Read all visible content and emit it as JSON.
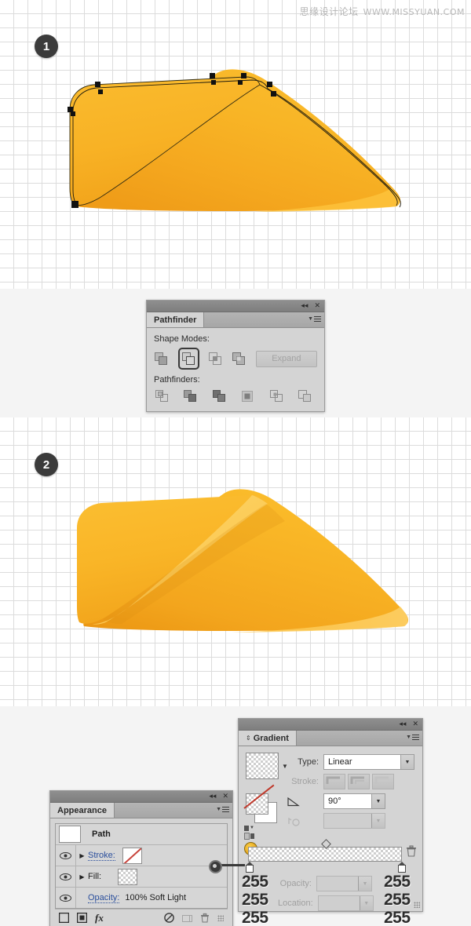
{
  "watermark": {
    "cn_text": "思缘设计论坛",
    "url_text": "WWW.MISSYUAN.COM"
  },
  "steps": [
    {
      "number": "1"
    },
    {
      "number": "2"
    }
  ],
  "illustration": {
    "name": "orange-cone-shape",
    "fill_light": "#F9B929",
    "fill_mid": "#F5A623",
    "fill_dark": "#E8951A",
    "highlight": "#FCCB4E"
  },
  "pathfinder_panel": {
    "tab_label": "Pathfinder",
    "shape_modes_label": "Shape Modes:",
    "pathfinders_label": "Pathfinders:",
    "expand_label": "Expand",
    "expand_enabled": false,
    "shape_modes": [
      {
        "name": "unite",
        "selected": false
      },
      {
        "name": "minus-front",
        "selected": true
      },
      {
        "name": "intersect",
        "selected": false
      },
      {
        "name": "exclude",
        "selected": false
      }
    ],
    "pathfinders": [
      {
        "name": "divide"
      },
      {
        "name": "trim"
      },
      {
        "name": "merge"
      },
      {
        "name": "crop"
      },
      {
        "name": "outline"
      },
      {
        "name": "minus-back"
      }
    ],
    "collapse_icon": "◂◂",
    "close_icon": "✕"
  },
  "appearance_panel": {
    "tab_label": "Appearance",
    "rows": [
      {
        "name": "path",
        "label": "Path",
        "type": "object"
      },
      {
        "name": "stroke",
        "label": "Stroke:",
        "type": "attr",
        "swatch": "none"
      },
      {
        "name": "fill",
        "label": "Fill:",
        "type": "attr",
        "swatch": "gradient"
      },
      {
        "name": "opacity",
        "label": "Opacity:",
        "value": "100% Soft Light",
        "type": "opacity"
      }
    ],
    "footer_icons": [
      {
        "name": "add-new-fill-icon"
      },
      {
        "name": "add-new-stroke-icon"
      },
      {
        "name": "add-new-effect-icon",
        "glyph": "fx"
      },
      {
        "name": "clear-appearance-icon",
        "glyph": "⃠"
      },
      {
        "name": "duplicate-item-icon"
      },
      {
        "name": "delete-item-icon",
        "glyph": "🗑"
      }
    ],
    "collapse_icon": "◂◂",
    "close_icon": "✕"
  },
  "gradient_panel": {
    "tab_label": "Gradient",
    "type_label": "Type:",
    "type_value": "Linear",
    "stroke_label": "Stroke:",
    "angle_label": "angle-icon",
    "angle_value": "90°",
    "aspect_label": "aspect-ratio-icon",
    "aspect_value": "",
    "opacity_label": "Opacity:",
    "opacity_value": "",
    "location_label": "Location:",
    "location_value": "",
    "stops": [
      {
        "name": "left-stop",
        "position": 0,
        "rgb": [
          "255",
          "255",
          "255"
        ]
      },
      {
        "name": "right-stop",
        "position": 100,
        "rgb": [
          "255",
          "255",
          "255"
        ]
      }
    ],
    "collapse_icon": "◂◂",
    "close_icon": "✕",
    "trash_icon": "🗑"
  }
}
